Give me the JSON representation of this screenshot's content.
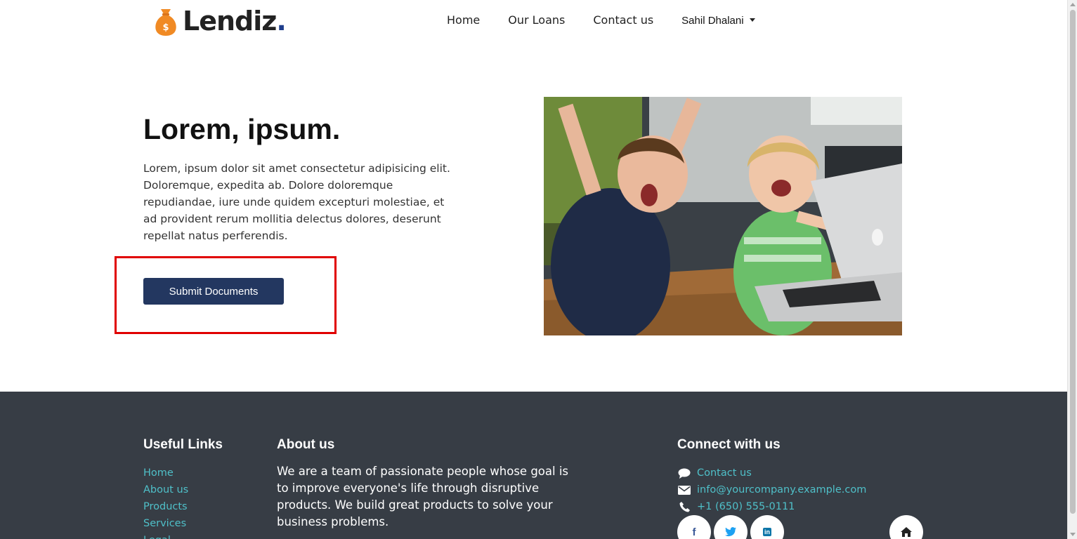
{
  "brand": {
    "name": "Lendiz",
    "dot": "."
  },
  "nav": {
    "links": [
      "Home",
      "Our Loans",
      "Contact us"
    ],
    "user": "Sahil Dhalani"
  },
  "hero": {
    "title": "Lorem, ipsum.",
    "text": "Lorem, ipsum dolor sit amet consectetur adipisicing elit. Doloremque, expedita ab. Dolore doloremque repudiandae, iure unde quidem excepturi molestiae, et ad provident rerum mollitia delectus dolores, deserunt repellat natus perferendis.",
    "button": "Submit Documents"
  },
  "footer": {
    "useful_links": {
      "heading": "Useful Links",
      "items": [
        "Home",
        "About us",
        "Products",
        "Services",
        "Legal"
      ]
    },
    "about": {
      "heading": "About us",
      "text": "We are a team of passionate people whose goal is to improve everyone's life through disruptive products. We build great products to solve your business problems."
    },
    "connect": {
      "heading": "Connect with us",
      "contact": "Contact us",
      "email": "info@yourcompany.example.com",
      "phone": "+1 (650) 555-0111"
    },
    "social": {
      "facebook": "f",
      "twitter": "t",
      "linkedin": "in"
    }
  },
  "colors": {
    "primary_button": "#233760",
    "footer_bg": "#373d45",
    "link": "#4fc0c9",
    "brand_icon": "#f08a24",
    "highlight": "#e00000"
  }
}
